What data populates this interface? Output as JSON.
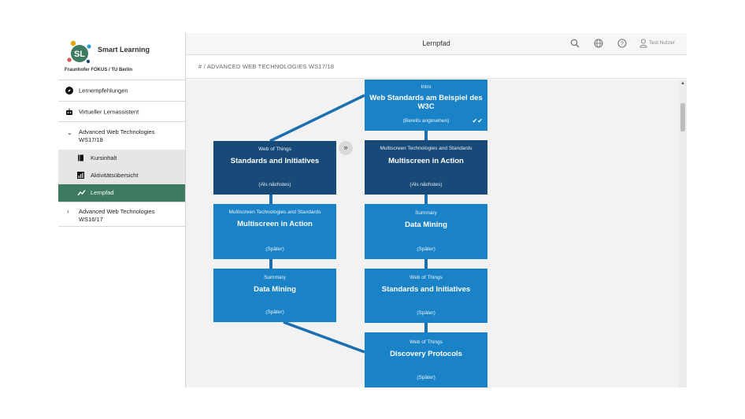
{
  "brand": {
    "title": "Smart Learning",
    "logo_text": "SL",
    "org": "Fraunhofer FOKUS / TU Berlin"
  },
  "sidebar": {
    "items": [
      {
        "label": "Lernempfehlungen",
        "icon": "compass-icon"
      },
      {
        "label": "Virtueller Lernassistent",
        "icon": "robot-icon"
      }
    ],
    "course_open": {
      "line1": "Advanced Web Technologies",
      "line2": "WS17/18",
      "icon": "chevron-down-icon"
    },
    "sub_items": [
      {
        "label": "Kursinhalt",
        "icon": "book-icon"
      },
      {
        "label": "Aktivitätsübersicht",
        "icon": "bar-chart-icon"
      },
      {
        "label": "Lernpfad",
        "icon": "line-chart-icon",
        "active": true
      }
    ],
    "course_closed": {
      "line1": "Advanced Web Technologies",
      "line2": "WS16/17",
      "icon": "chevron-right-icon"
    }
  },
  "topbar": {
    "title": "Lernpfad",
    "icons": [
      "search-icon",
      "globe-icon",
      "help-icon",
      "user-icon"
    ],
    "user": "Test Nutzer"
  },
  "breadcrumb": {
    "home": "# /",
    "course": "ADVANCED WEB TECHNOLOGIES WS17/18"
  },
  "colors": {
    "card_light": "#1a83c8",
    "card_dark": "#174a79",
    "active_nav": "#3d7a5f",
    "connector": "#1a6fb0"
  },
  "path": {
    "right": [
      {
        "category": "Intro",
        "name": "Web Standards am Beispiel des W3C",
        "status": "(Bereits angesehen)",
        "style": "light",
        "seen": true
      },
      {
        "category": "Multiscreen Technologies and Standards",
        "name": "Multiscreen in Action",
        "status": "(Als nächstes)",
        "style": "dark"
      },
      {
        "category": "Summary",
        "name": "Data Mining",
        "status": "(Später)",
        "style": "light"
      },
      {
        "category": "Web of Things",
        "name": "Standards and Initiatives",
        "status": "(Später)",
        "style": "light"
      },
      {
        "category": "Web of Things",
        "name": "Discovery Protocols",
        "status": "(Später)",
        "style": "light"
      }
    ],
    "left": [
      {
        "category": "Web of Things",
        "name": "Standards and Initiatives",
        "status": "(Als nächstes)",
        "style": "dark"
      },
      {
        "category": "Multiscreen Technologies and Standards",
        "name": "Multiscreen in Action",
        "status": "(Später)",
        "style": "light"
      },
      {
        "category": "Summary",
        "name": "Data Mining",
        "status": "(Später)",
        "style": "light"
      }
    ],
    "next_button": "»"
  }
}
